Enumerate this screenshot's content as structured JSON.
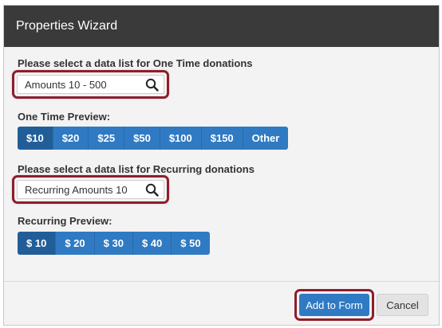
{
  "dialog": {
    "title": "Properties Wizard"
  },
  "one_time": {
    "label": "Please select a data list for One Time donations",
    "search_value": "Amounts 10 - 500",
    "preview_label": "One Time Preview:",
    "amounts": [
      "$10",
      "$20",
      "$25",
      "$50",
      "$100",
      "$150",
      "Other"
    ],
    "selected_index": 0
  },
  "recurring": {
    "label": "Please select a data list for Recurring donations",
    "search_value": "Recurring Amounts 10",
    "preview_label": "Recurring Preview:",
    "amounts": [
      "$ 10",
      "$ 20",
      "$ 30",
      "$ 40",
      "$ 50"
    ],
    "selected_index": 0
  },
  "footer": {
    "add_label": "Add to Form",
    "cancel_label": "Cancel"
  },
  "colors": {
    "titlebar": "#3a3a3a",
    "primary": "#2f7ac3",
    "primary_active": "#215e98",
    "highlight_outline": "#8f1d2c"
  },
  "icons": {
    "search": "search-icon"
  }
}
